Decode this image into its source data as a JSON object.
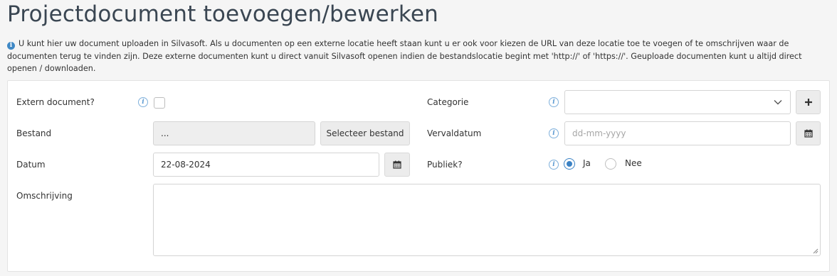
{
  "page": {
    "title": "Projectdocument toevoegen/bewerken",
    "intro": "U kunt hier uw document uploaden in Silvasoft. Als u documenten op een externe locatie heeft staan kunt u er ook voor kiezen de URL van deze locatie toe te voegen of te omschrijven waar de documenten terug te vinden zijn. Deze externe documenten kunt u direct vanuit Silvasoft openen indien de bestandslocatie begint met 'http://' of 'https://'. Geuploade documenten kunt u altijd direct openen / downloaden.",
    "info_icon": "info-circle-icon"
  },
  "form": {
    "extern": {
      "label": "Extern document?",
      "checked": false
    },
    "bestand": {
      "label": "Bestand",
      "value": "...",
      "button_label": "Selecteer bestand"
    },
    "datum": {
      "label": "Datum",
      "value": "22-08-2024",
      "icon": "calendar-icon"
    },
    "omschrijving": {
      "label": "Omschrijving",
      "value": ""
    },
    "categorie": {
      "label": "Categorie",
      "value": "",
      "add_icon": "plus-icon"
    },
    "vervaldatum": {
      "label": "Vervaldatum",
      "placeholder": "dd-mm-yyyy",
      "icon": "calendar-icon"
    },
    "publiek": {
      "label": "Publiek?",
      "option_yes": "Ja",
      "option_no": "Nee",
      "selected": "Ja"
    }
  },
  "colors": {
    "accent": "#3b82c4",
    "title": "#3a4652",
    "help_icon": "#5d9bd2"
  }
}
